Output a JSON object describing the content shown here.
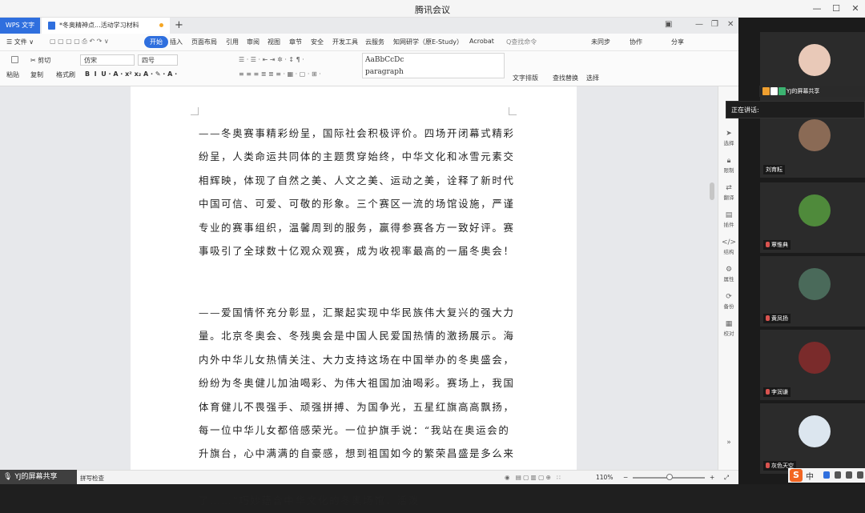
{
  "meeting": {
    "title": "腾讯会议"
  },
  "wps": {
    "app_tab": "WPS 文字",
    "doc_tab": "*冬奥精神点...活动学习材料",
    "menu": {
      "file": "☰ 文件 ∨",
      "items": [
        "开始",
        "插入",
        "页面布局",
        "引用",
        "审阅",
        "视图",
        "章节",
        "安全",
        "开发工具",
        "云服务",
        "知网研学（原E-Study）",
        "Acrobat"
      ],
      "search": "Q查找命令",
      "right": [
        "未同步",
        "协作",
        "分享"
      ]
    },
    "ribbon": {
      "cut": "剪切",
      "copy": "复制",
      "format_painter": "格式刷",
      "paste": "粘贴",
      "font": "仿宋",
      "font_size": "四号",
      "style_preview": "AaBbCcDc",
      "style_name": "paragraph",
      "text_layout": "文字排版",
      "find_replace": "查找替换",
      "select": "选择"
    },
    "paragraph1": "——冬奥赛事精彩纷呈，国际社会积极评价。四场开闭幕式精彩纷呈，人类命运共同体的主题贯穿始终，中华文化和冰雪元素交相辉映，体现了自然之美、人文之美、运动之美，诠释了新时代中国可信、可爱、可敬的形象。三个赛区一流的场馆设施，严谨专业的赛事组织，温馨周到的服务，赢得参赛各方一致好评。赛事吸引了全球数十亿观众观赛，成为收视率最高的一届冬奥会！",
    "paragraph2": "——爱国情怀充分彰显，汇聚起实现中华民族伟大复兴的强大力量。北京冬奥会、冬残奥会是中国人民爱国热情的激扬展示。海内外中华儿女热情关注、大力支持这场在中国举办的冬奥盛会，纷纷为冬奥健儿加油喝彩、为伟大祖国加油喝彩。赛场上，我国体育健儿不畏强手、顽强拼搏、为国争光，五星红旗高高飘扬，每一位中华儿女都倍感荣光。一位护旗手说：“我站在奥运会的升旗台，心中满满的自豪感，想到祖国如今的繁荣昌盛是多么来之不易，那是一种说不出的骄傲与热爱，泪水就夺眶而出了……”巧妙蕴含中华文化的冬奥场馆，活泼",
    "side_tools": [
      "选择",
      "限制",
      "翻译",
      "插件",
      "结构",
      "属性",
      "备份",
      "校对"
    ],
    "status": {
      "spellcheck": "拼写检查",
      "zoom": "110%"
    }
  },
  "share_badge": "YJ的屏幕共享",
  "panel": {
    "sharer": "YJ的屏幕共享",
    "speaking": "正在讲话:",
    "participants": [
      {
        "name": "",
        "color": "#e9c9b8"
      },
      {
        "name": "刘育耘",
        "color": "#8a6a55"
      },
      {
        "name": "覃惟典",
        "color": "#4f8a3b"
      },
      {
        "name": "黄凤扬",
        "color": "#4a6a5a"
      },
      {
        "name": "李润谦",
        "color": "#7a2b2b"
      },
      {
        "name": "灰色天空",
        "color": "#dce6ef"
      }
    ]
  },
  "ime": {
    "lang": "中"
  },
  "colors": {
    "accent": "#2f6fde",
    "panel": "#1b1b1b"
  }
}
